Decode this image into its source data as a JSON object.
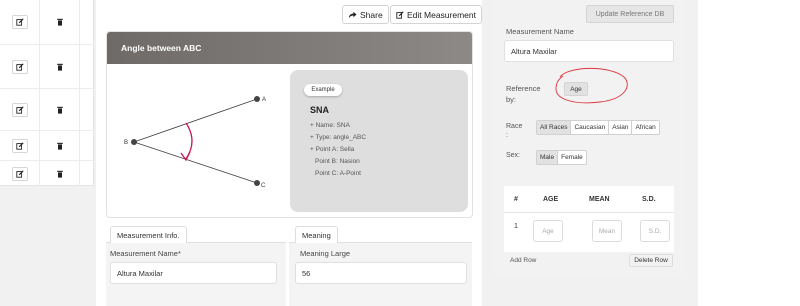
{
  "toolbar": {
    "share_label": "Share",
    "edit_label": "Edit Measurement"
  },
  "diagram": {
    "title": "Angle between ABC",
    "point_a": "A",
    "point_b": "B",
    "point_c": "C"
  },
  "example": {
    "badge": "Example",
    "name": "SNA",
    "lines": [
      "+ Name: SNA",
      "+ Type: angle_ABC",
      "+ Point A: Sella",
      "Point B: Nasion",
      "Point C: A-Point"
    ]
  },
  "measurement_info": {
    "tab_label": "Measurement Info.",
    "name_label": "Measurement Name*",
    "name_value": "Altura Maxilar"
  },
  "meaning": {
    "tab_label": "Meaning",
    "large_label": "Meaning Large",
    "large_value": "56"
  },
  "reference": {
    "update_label": "Update Reference DB",
    "name_label": "Measurement Name",
    "name_value": "Altura Maxilar",
    "reference_by_label": "Reference\nby:",
    "reference_by_value": "Age",
    "race_label": "Race\n:",
    "race_options": [
      "All Races",
      "Caucasian",
      "Asian",
      "African"
    ],
    "race_selected": "All Races",
    "sex_label": "Sex:",
    "sex_options": [
      "Male",
      "Female"
    ],
    "sex_selected": "Male",
    "table": {
      "headers": [
        "#",
        "AGE",
        "MEAN",
        "S.D."
      ],
      "row_number": "1",
      "placeholders": [
        "Age",
        "Mean",
        "S.D."
      ]
    },
    "add_row_label": "Add Row",
    "delete_row_label": "Delete Row"
  },
  "colors": {
    "header_gradient_start": "#6d6a68",
    "annotation_red": "#d9363e",
    "angle_arc": "#c2185b"
  },
  "icons": {
    "edit": "edit-icon",
    "delete": "trash-icon",
    "share": "share-icon",
    "edit_measurement": "edit-icon"
  }
}
